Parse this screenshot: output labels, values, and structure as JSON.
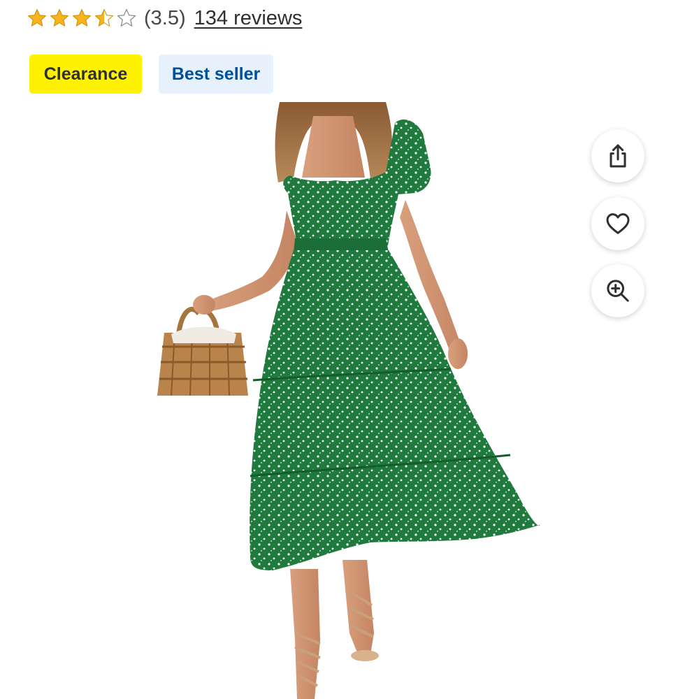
{
  "rating": {
    "stars_filled": 3.5,
    "stars_total": 5,
    "value_text": "(3.5)",
    "reviews_text": "134 reviews",
    "star_color": "#f7b41c"
  },
  "badges": [
    {
      "label": "Clearance",
      "bg": "#fff200",
      "color": "#2e2f32"
    },
    {
      "label": "Best seller",
      "bg": "#e6f1fc",
      "color": "#004f9a"
    }
  ],
  "actions": [
    {
      "icon": "share-icon"
    },
    {
      "icon": "heart-icon"
    },
    {
      "icon": "zoom-in-icon"
    }
  ],
  "product_image": {
    "dress_color": "#1f7a3d",
    "dot_color": "#ffffff"
  }
}
